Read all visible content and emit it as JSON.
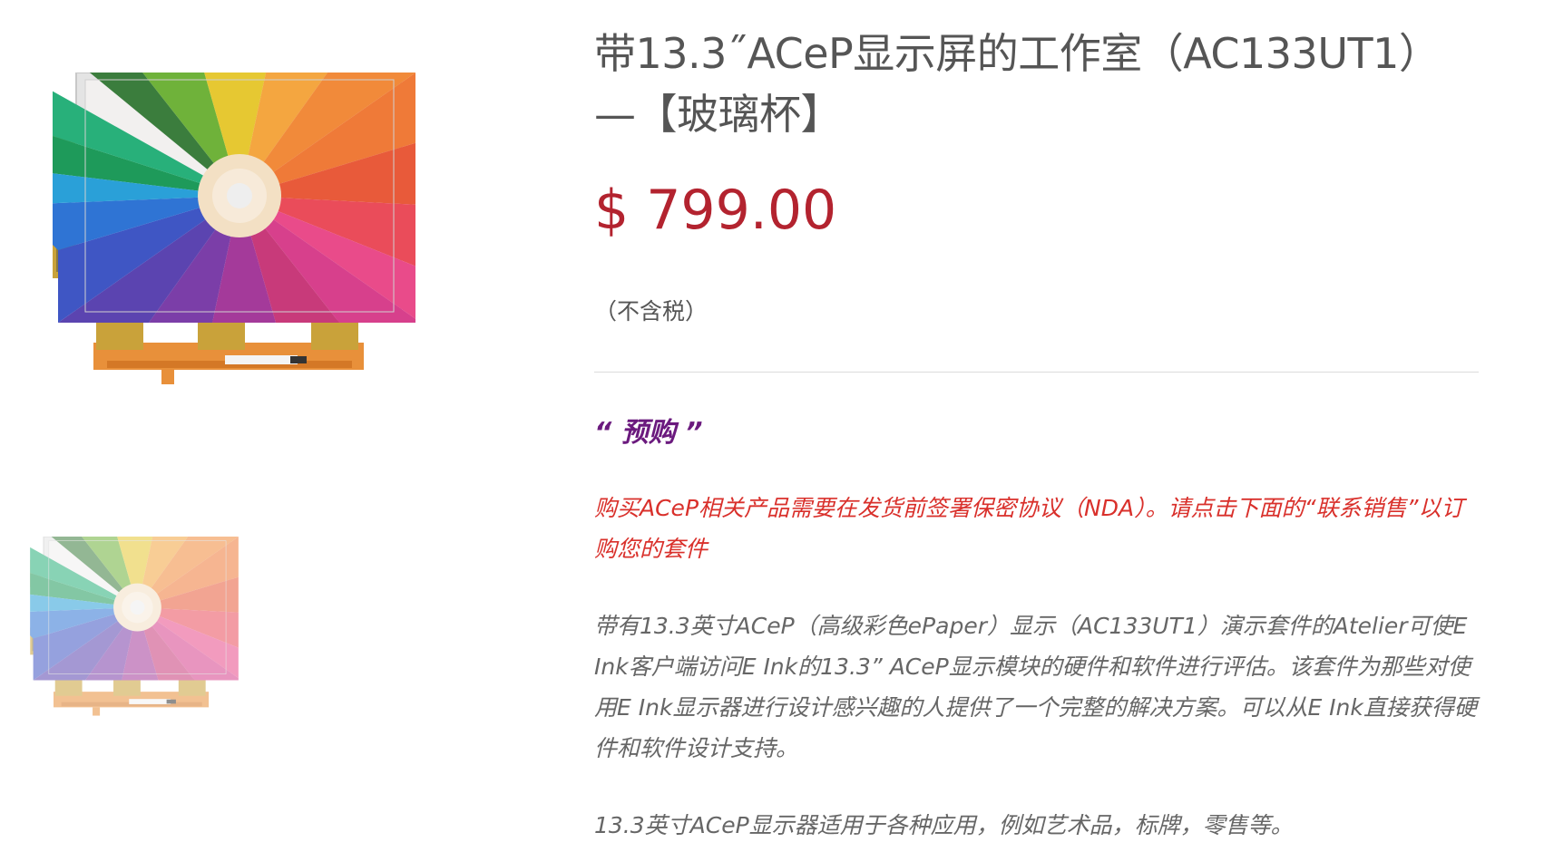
{
  "product": {
    "title": "带13.3˝ACeP显示屏的工作室（AC133UT1）—【玻璃杯】",
    "price": "$ 799.00",
    "tax_note": "（不含税）",
    "preorder_label": "“ 预购 ”",
    "notice": "购买ACeP相关产品需要在发货前签署保密协议（NDA）。请点击下面的“联系销售”以订购您的套件",
    "description": "带有13.3英寸ACeP（高级彩色ePaper）显示（AC133UT1）演示套件的Atelier可使E Ink客户端访问E Ink的13.3” ACeP显示模块的硬件和软件进行评估。该套件为那些对使用E Ink显示器进行设计感兴趣的人提供了一个完整的解决方案。可以从E Ink直接获得硬件和软件设计支持。",
    "applications": "13.3英寸ACeP显示器适用于各种应用，例如艺术品，标牌，零售等。"
  },
  "gallery": {
    "main_image": "acep-display-pencils-image",
    "thumbnails": [
      "acep-display-pencils-thumbnail"
    ]
  },
  "colors": {
    "price": "#b3232f",
    "preorder": "#6b1a7e",
    "notice": "#d9302b",
    "text": "#555555"
  }
}
